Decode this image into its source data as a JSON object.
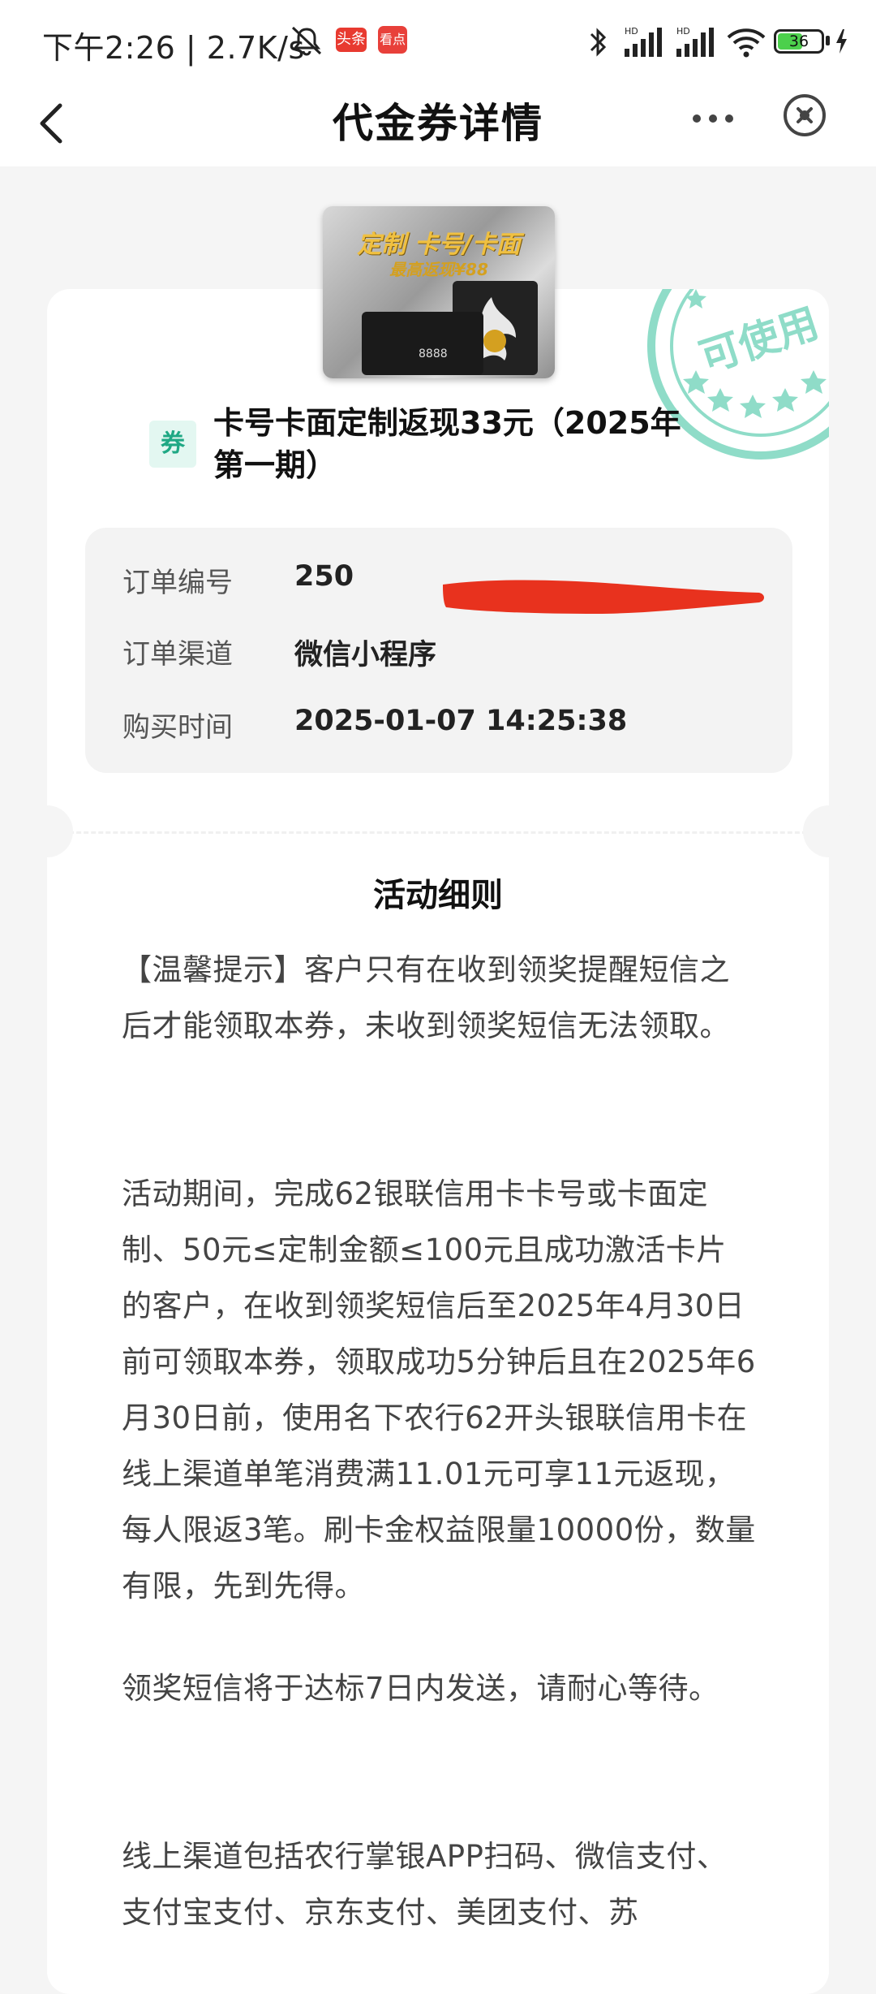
{
  "status_bar": {
    "time": "下午2:26 | 2.7K/s",
    "app1": "头条",
    "app2": "看点",
    "battery": "36",
    "icons": [
      "mute-icon",
      "bluetooth-icon",
      "signal-hd-icon",
      "signal-hd-icon",
      "wifi-icon",
      "battery-icon",
      "charging-icon"
    ]
  },
  "nav": {
    "title": "代金券详情",
    "icons": [
      "back-icon",
      "more-icon",
      "close-icon"
    ]
  },
  "voucher": {
    "stamp": "可使用",
    "card_image": {
      "caption": "定制 卡号/卡面",
      "subcaption": "最高返现¥88",
      "card_number": "8888"
    },
    "tag": "券",
    "title": "卡号卡面定制返现33元（2025年第一期）"
  },
  "order": {
    "rows": [
      {
        "label": "订单编号",
        "value": "250"
      },
      {
        "label": "订单渠道",
        "value": "微信小程序"
      },
      {
        "label": "购买时间",
        "value": "2025-01-07 14:25:38"
      }
    ]
  },
  "rules": {
    "title": "活动细则",
    "paragraphs": [
      "【温馨提示】客户只有在收到领奖提醒短信之后才能领取本券，未收到领奖短信无法领取。",
      "活动期间，完成62银联信用卡卡号或卡面定制、50元≤定制金额≤100元且成功激活卡片的客户，在收到领奖短信后至2025年4月30日前可领取本券，领取成功5分钟后且在2025年6月30日前，使用名下农行62开头银联信用卡在线上渠道单笔消费满11.01元可享11元返现，每人限返3笔。刷卡金权益限量10000份，数量有限，先到先得。",
      "领奖短信将于达标7日内发送，请耐心等待。",
      "线上渠道包括农行掌银APP扫码、微信支付、支付宝支付、京东支付、美团支付、苏"
    ]
  },
  "colors": {
    "accent": "#1fa884",
    "stamp": "#8fdcc8",
    "redaction": "#e8321e"
  }
}
